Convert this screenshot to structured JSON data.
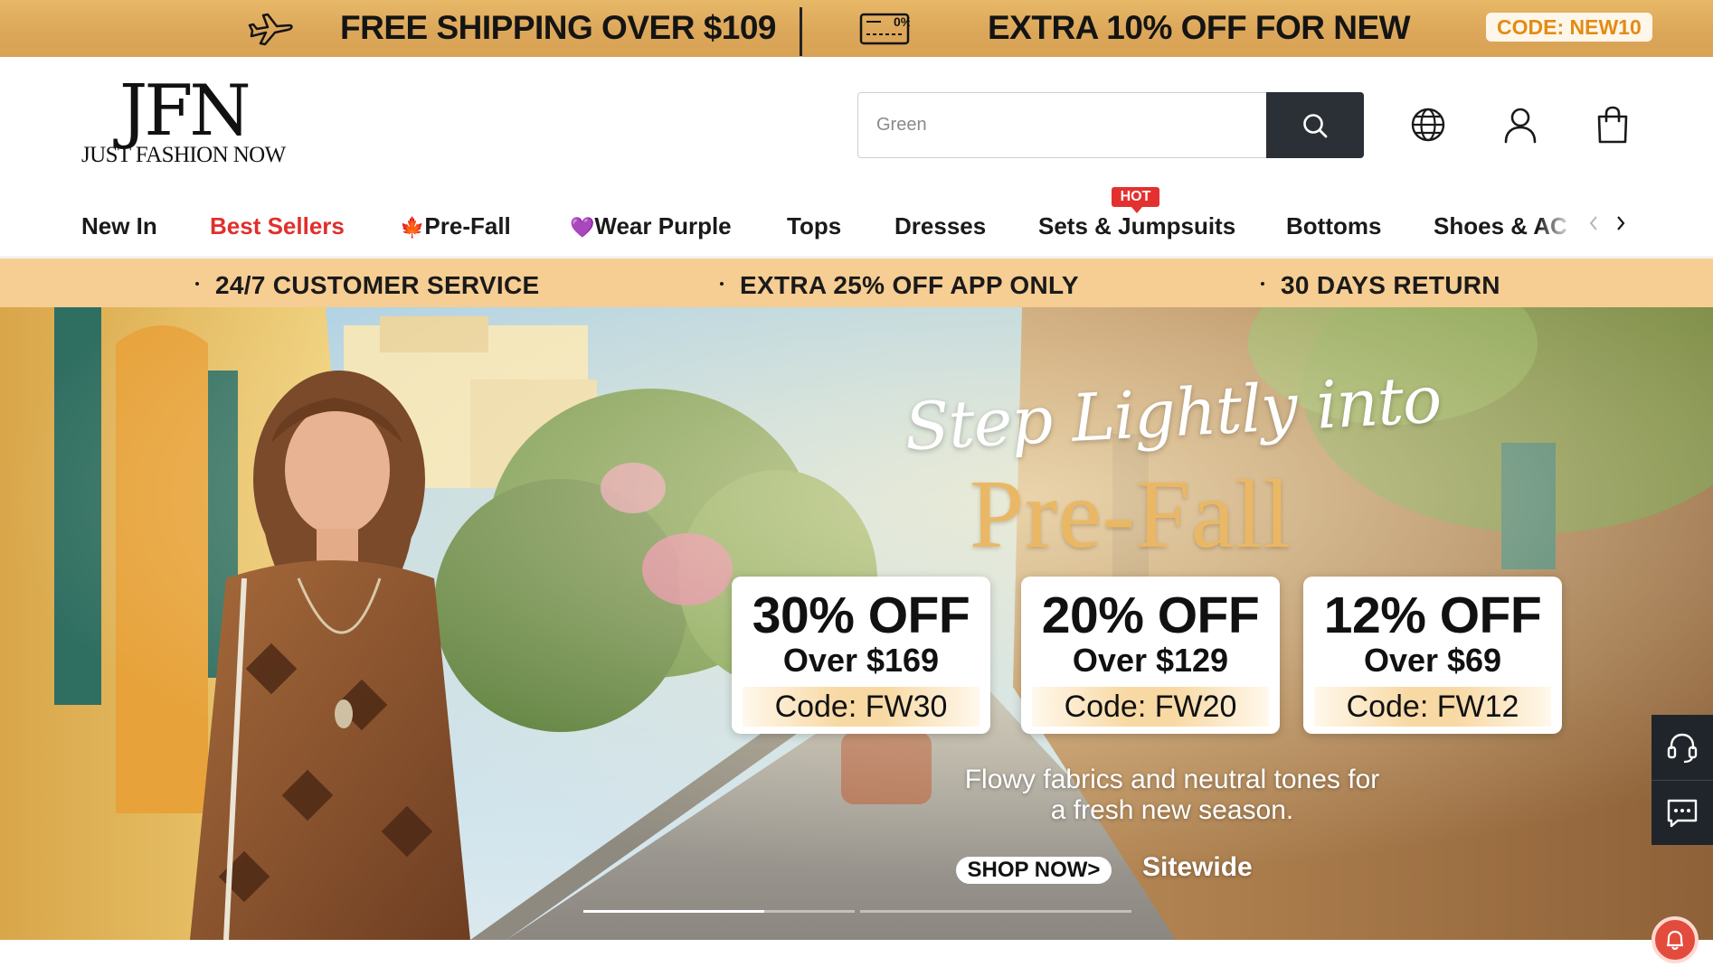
{
  "promo": {
    "shipping_text": "FREE SHIPPING OVER $109",
    "extra_text": "EXTRA 10% OFF FOR NEW",
    "code_text": "CODE: NEW10",
    "coupon_icon_label": "0%"
  },
  "header": {
    "logo_mark": "JFN",
    "logo_tagline": "JUST FASHION NOW",
    "search_placeholder": "Green",
    "icons": [
      "globe-icon",
      "account-icon",
      "shopping-bag-icon",
      "search-icon"
    ]
  },
  "nav": {
    "items": [
      {
        "label": "New In",
        "highlight": false
      },
      {
        "label": "Best Sellers",
        "highlight": true
      },
      {
        "label": "Pre-Fall",
        "emoji": "🍁"
      },
      {
        "label": "Wear Purple",
        "emoji": "💜"
      },
      {
        "label": "Tops"
      },
      {
        "label": "Dresses"
      },
      {
        "label": "Sets & Jumpsuits"
      },
      {
        "label": "Bottoms"
      },
      {
        "label": "Shoes & AC"
      }
    ],
    "hot_badge": "HOT"
  },
  "service": {
    "items": [
      "24/7 CUSTOMER SERVICE",
      "EXTRA 25% OFF APP ONLY",
      "30 DAYS RETURN"
    ]
  },
  "hero": {
    "script_line": "Step Lightly into",
    "title": "Pre-Fall",
    "offers": [
      {
        "pct": "30% OFF",
        "min": "Over $169",
        "code": "Code: FW30"
      },
      {
        "pct": "20% OFF",
        "min": "Over $129",
        "code": "Code: FW20"
      },
      {
        "pct": "12% OFF",
        "min": "Over $69",
        "code": "Code: FW12"
      }
    ],
    "sub_line1": "Flowy fabrics and neutral tones for",
    "sub_line2": "a fresh new season.",
    "shop_now": "SHOP NOW>",
    "sitewide": "Sitewide",
    "slides_count": 2,
    "active_slide": 1
  },
  "colors": {
    "promo_bg": "#dca75a",
    "accent_red": "#e0302c",
    "service_bg": "#f6cd92",
    "search_btn": "#2b3036",
    "code_orange": "#e28c14",
    "title_gold": "#eab864"
  }
}
